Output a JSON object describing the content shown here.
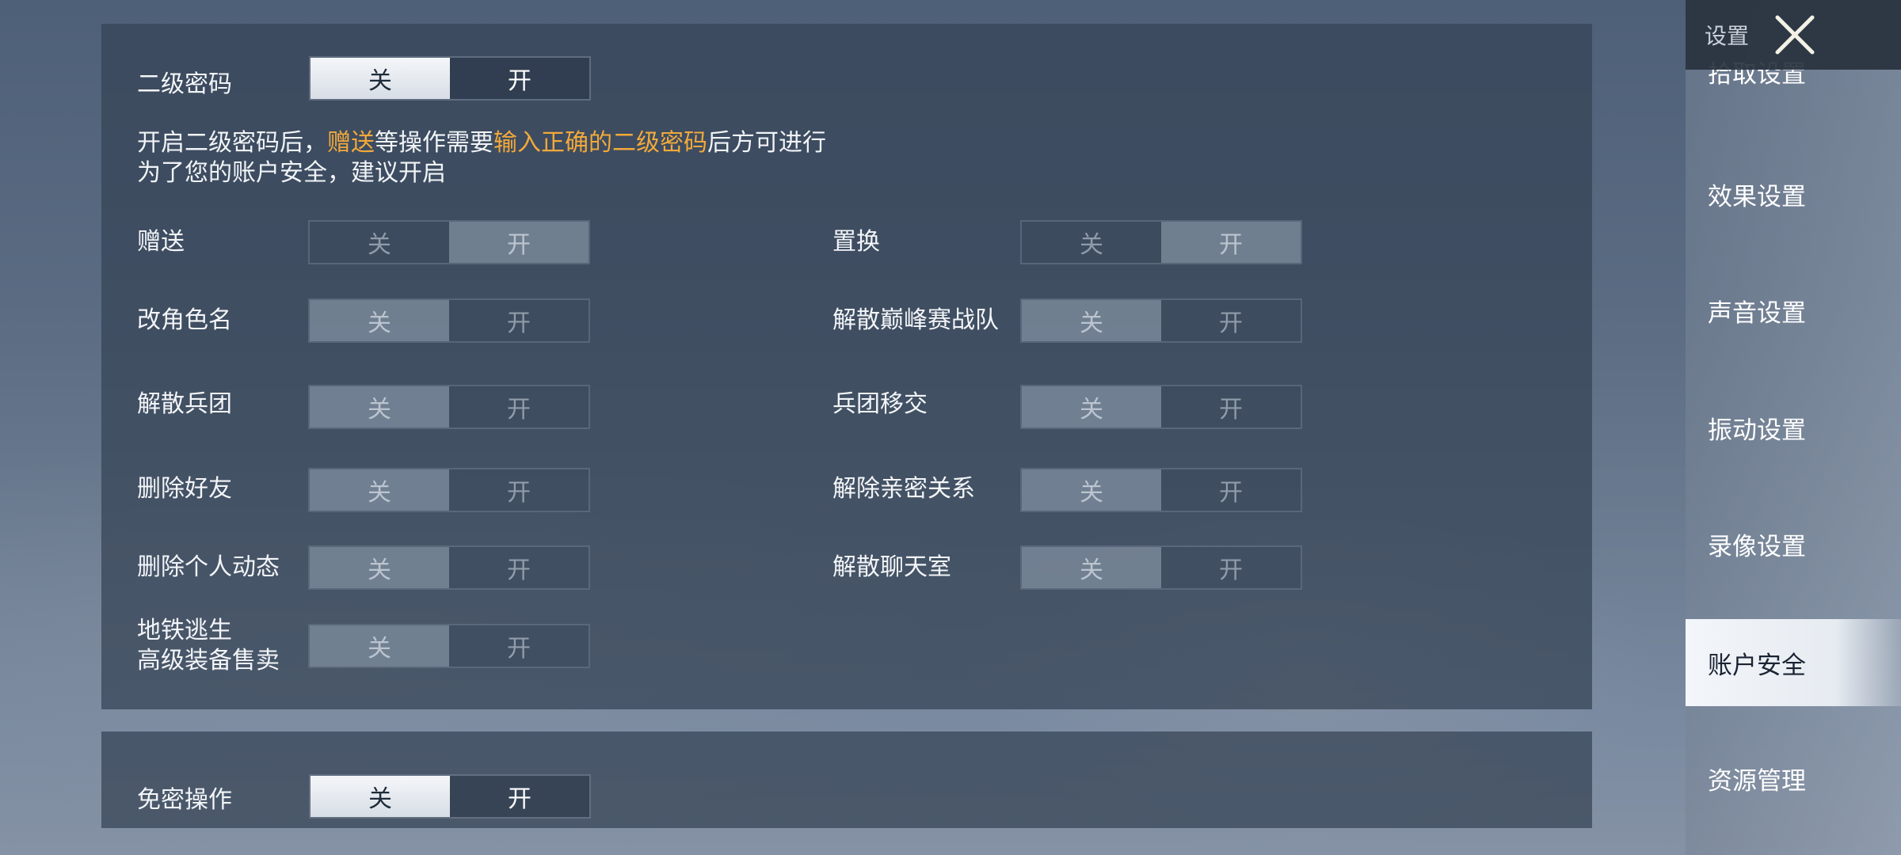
{
  "account_security": {
    "secondary_password": {
      "label": "二级密码",
      "off": "关",
      "on": "开",
      "selected": "off"
    },
    "description": {
      "line1_a": "开启二级密码后，",
      "line1_hl1": "赠送",
      "line1_b": "等操作需要",
      "line1_hl2": "输入正确的二级密码",
      "line1_c": "后方可进行",
      "line2": "为了您的账户安全，建议开启"
    },
    "operations": [
      {
        "label": "赠送",
        "selected": "on"
      },
      {
        "label": "置换",
        "selected": "on"
      },
      {
        "label": "改角色名",
        "selected": "off"
      },
      {
        "label": "解散巅峰赛战队",
        "selected": "off"
      },
      {
        "label": "解散兵团",
        "selected": "off"
      },
      {
        "label": "兵团移交",
        "selected": "off"
      },
      {
        "label": "删除好友",
        "selected": "off"
      },
      {
        "label": "解除亲密关系",
        "selected": "off"
      },
      {
        "label": "删除个人动态",
        "selected": "off"
      },
      {
        "label": "解散聊天室",
        "selected": "off"
      },
      {
        "label_line1": "地铁逃生",
        "label_line2": "高级装备售卖",
        "selected": "off"
      }
    ],
    "toggle_off": "关",
    "toggle_on": "开",
    "password_free": {
      "label": "免密操作",
      "off": "关",
      "on": "开",
      "selected": "off"
    }
  },
  "sidebar": {
    "title": "设置",
    "items": [
      {
        "label": "拾取设置"
      },
      {
        "label": "效果设置"
      },
      {
        "label": "声音设置"
      },
      {
        "label": "振动设置"
      },
      {
        "label": "录像设置"
      },
      {
        "label": "账户安全",
        "active": true
      },
      {
        "label": "资源管理"
      }
    ]
  },
  "colors": {
    "highlight": "#f2a93b",
    "active_tab_bg": "#eef2f6"
  },
  "icons": {
    "close": "close-x-icon"
  }
}
